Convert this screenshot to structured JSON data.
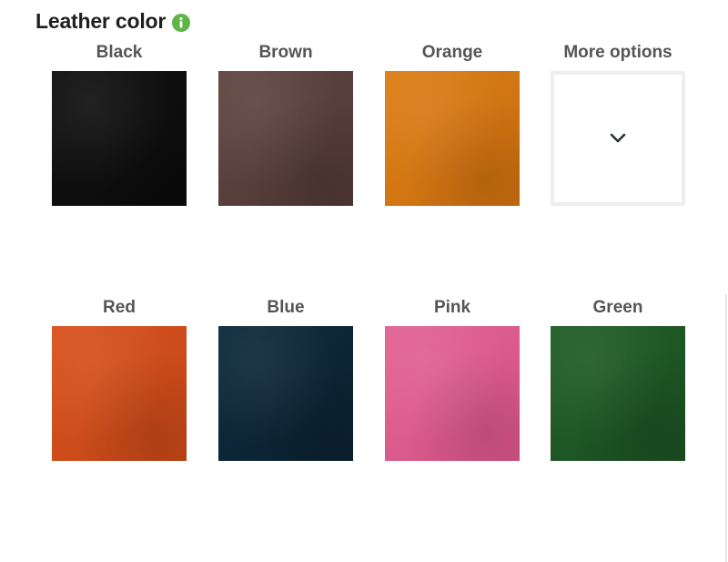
{
  "section": {
    "title": "Leather color",
    "info_icon": "info-circle-icon",
    "info_icon_color": "#5fb548"
  },
  "options": [
    {
      "label": "Black",
      "color": "#131313",
      "color_dark": "#0a0a0a"
    },
    {
      "label": "Brown",
      "color": "#634843",
      "color_dark": "#4e3633"
    },
    {
      "label": "Orange",
      "color": "#dd7f18",
      "color_dark": "#c86c0e"
    },
    {
      "label": "More options",
      "icon": "chevron-down-icon"
    },
    {
      "label": "Red",
      "color": "#d9531f",
      "color_dark": "#c24516"
    },
    {
      "label": "Blue",
      "color": "#0f2c3e",
      "color_dark": "#0a2030"
    },
    {
      "label": "Pink",
      "color": "#e26495",
      "color_dark": "#d45284"
    },
    {
      "label": "Green",
      "color": "#235f2a",
      "color_dark": "#1a4e20"
    }
  ]
}
